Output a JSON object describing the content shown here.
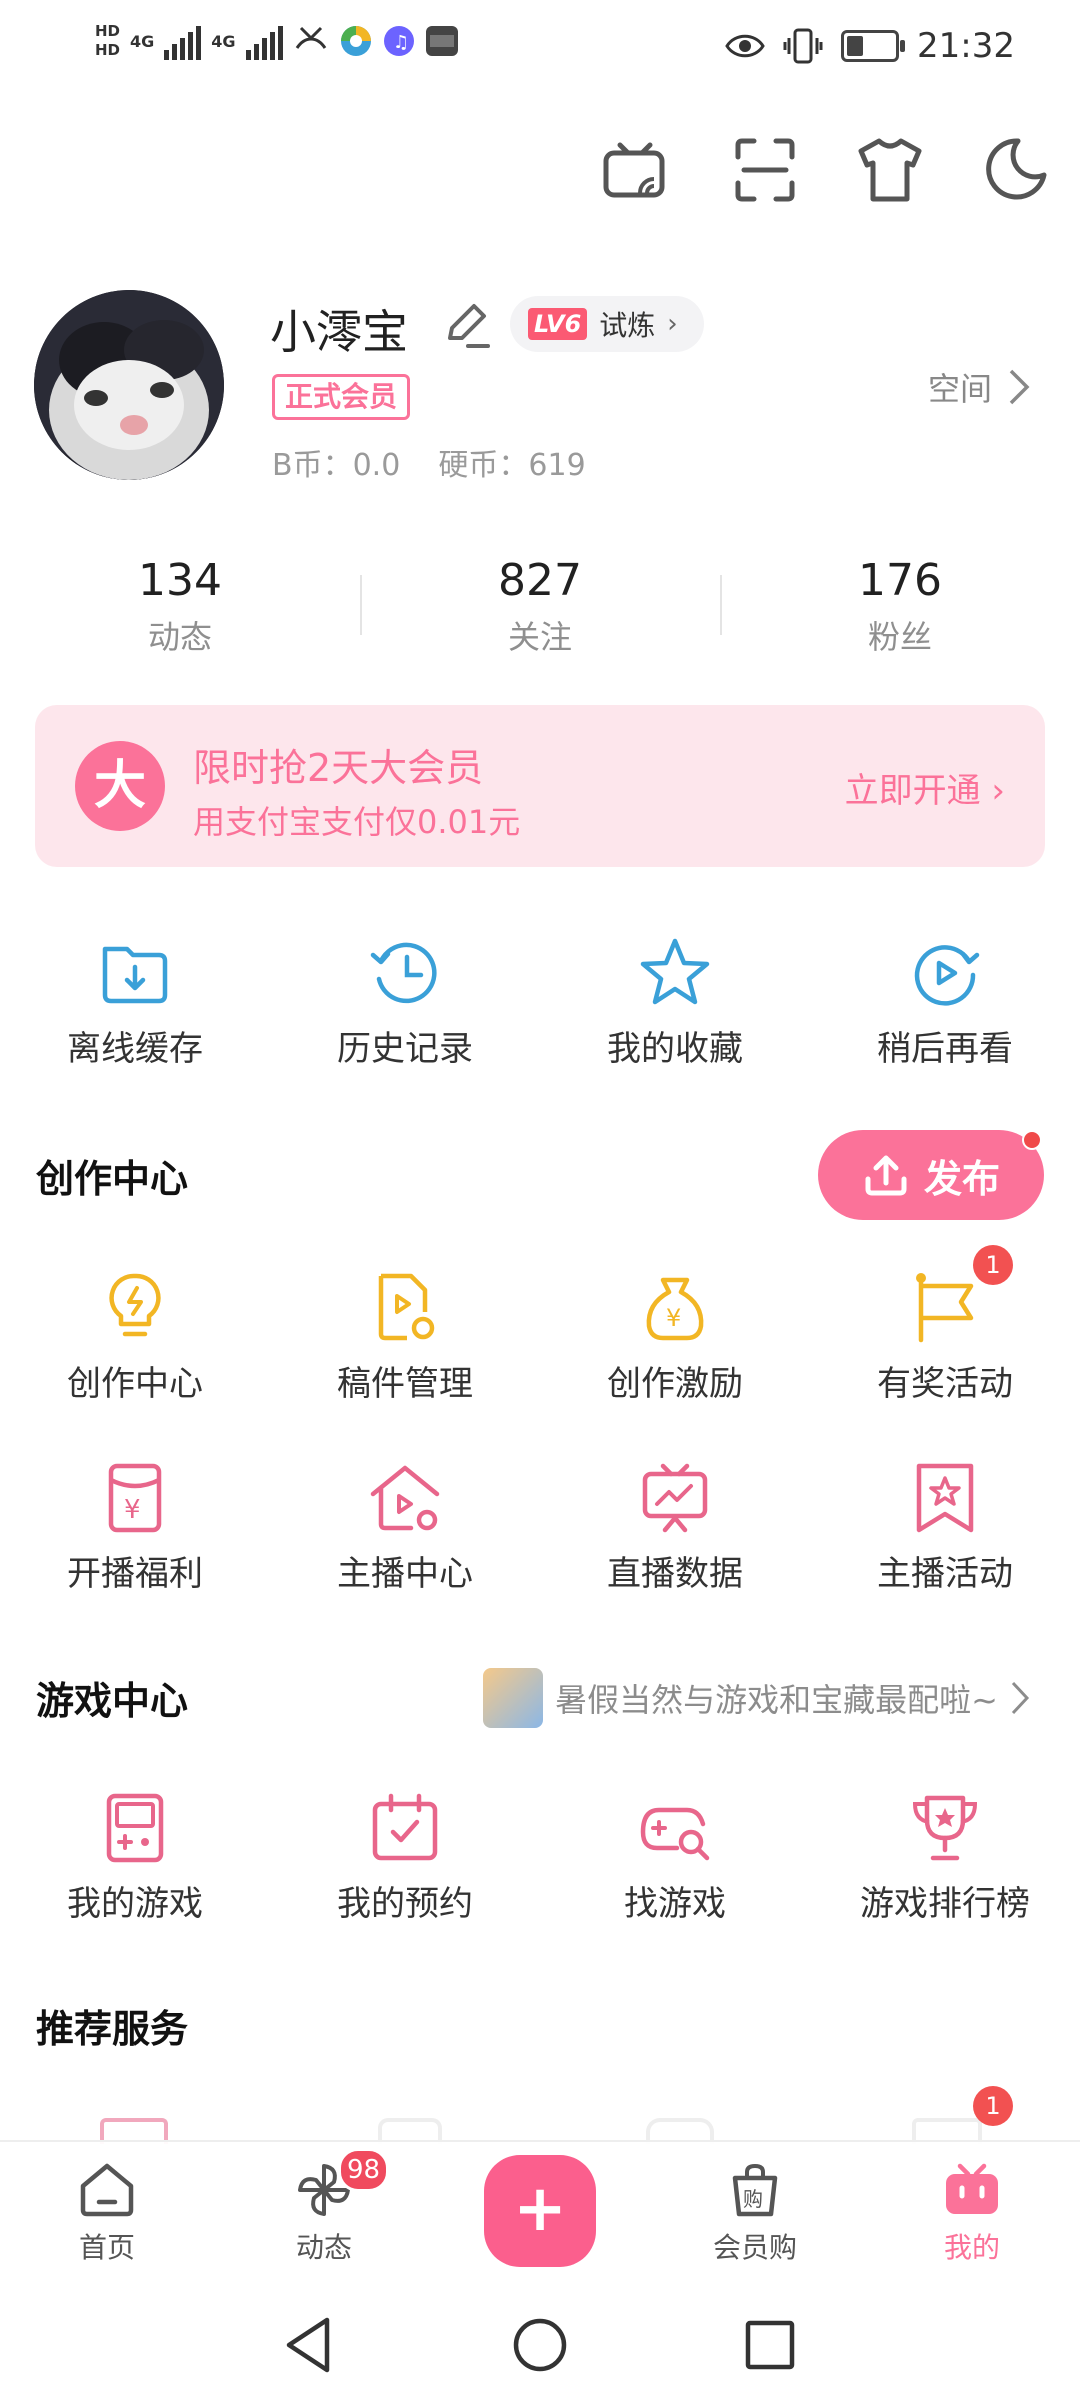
{
  "status_bar": {
    "hd1": "HD",
    "hd2": "HD",
    "net1": "4G",
    "net2": "4G",
    "time": "21:32"
  },
  "colors": {
    "accent": "#fb7299",
    "publish": "#fb7299",
    "icon_blue": "#3aa0d8",
    "icon_yellow": "#f2b624",
    "badge_red": "#f25151"
  },
  "top_icons": [
    "tv-cast-icon",
    "scan-icon",
    "shirt-icon",
    "moon-icon"
  ],
  "profile": {
    "username": "小澪宝",
    "level_badge": "LV6",
    "level_text": "试炼",
    "vip_label": "正式会员",
    "coins": "B币：0.0    硬币：619",
    "space_label": "空间"
  },
  "stats": [
    {
      "value": "134",
      "label": "动态"
    },
    {
      "value": "827",
      "label": "关注"
    },
    {
      "value": "176",
      "label": "粉丝"
    }
  ],
  "banner": {
    "icon_text": "大",
    "title": "限时抢2天大会员",
    "subtitle": "用支付宝支付仅0.01元",
    "cta": "立即开通"
  },
  "quick_actions": [
    {
      "label": "离线缓存",
      "icon": "download-folder-icon"
    },
    {
      "label": "历史记录",
      "icon": "history-clock-icon"
    },
    {
      "label": "我的收藏",
      "icon": "star-icon"
    },
    {
      "label": "稍后再看",
      "icon": "watch-later-icon"
    }
  ],
  "creation": {
    "title": "创作中心",
    "publish_label": "发布",
    "items": [
      {
        "label": "创作中心",
        "icon": "lightbulb-icon"
      },
      {
        "label": "稿件管理",
        "icon": "manuscript-icon"
      },
      {
        "label": "创作激励",
        "icon": "money-bag-icon"
      },
      {
        "label": "有奖活动",
        "icon": "flag-icon",
        "badge": "1"
      },
      {
        "label": "开播福利",
        "icon": "red-packet-icon"
      },
      {
        "label": "主播中心",
        "icon": "streamer-home-icon"
      },
      {
        "label": "直播数据",
        "icon": "live-data-icon"
      },
      {
        "label": "主播活动",
        "icon": "bookmark-star-icon"
      }
    ]
  },
  "game": {
    "title": "游戏中心",
    "note": "暑假当然与游戏和宝藏最配啦~",
    "items": [
      {
        "label": "我的游戏",
        "icon": "gameboy-icon"
      },
      {
        "label": "我的预约",
        "icon": "calendar-check-icon"
      },
      {
        "label": "找游戏",
        "icon": "gamepad-search-icon"
      },
      {
        "label": "游戏排行榜",
        "icon": "trophy-icon"
      }
    ]
  },
  "recommend": {
    "title": "推荐服务",
    "badge": "1"
  },
  "bottom_nav": [
    {
      "label": "首页",
      "icon": "home-icon"
    },
    {
      "label": "动态",
      "icon": "pinwheel-icon",
      "badge": "98"
    },
    {
      "label": "",
      "icon": "plus-icon"
    },
    {
      "label": "会员购",
      "icon": "shopping-bag-icon"
    },
    {
      "label": "我的",
      "icon": "tv-mascot-icon"
    }
  ],
  "plus_symbol": "+"
}
